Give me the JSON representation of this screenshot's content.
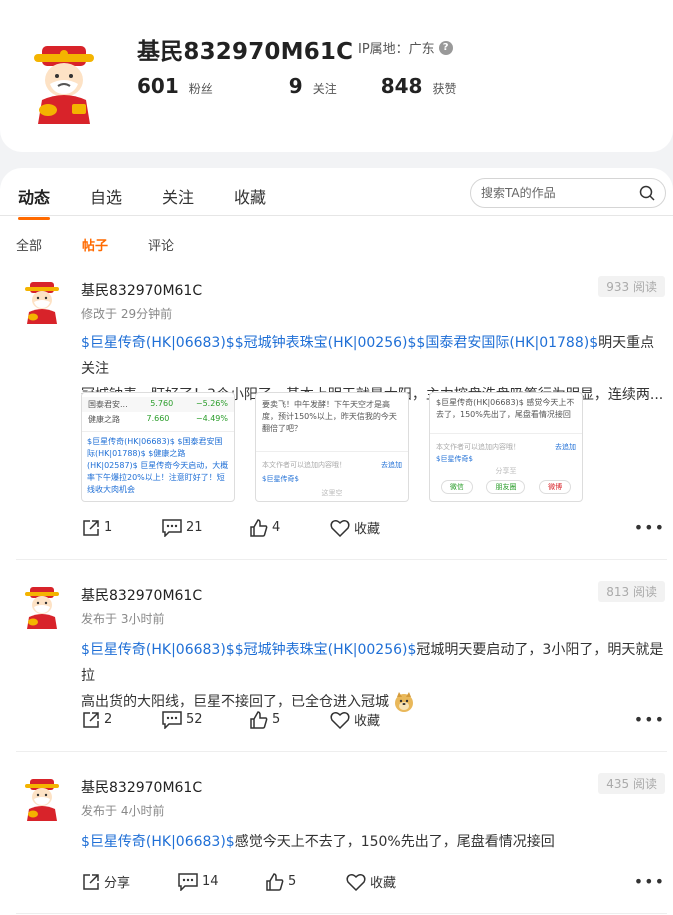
{
  "profile": {
    "username": "基民832970M61C",
    "ip_label": "IP属地：广东",
    "stats": [
      {
        "num": "601",
        "label": "粉丝"
      },
      {
        "num": "9",
        "label": "关注"
      },
      {
        "num": "848",
        "label": "获赞"
      }
    ]
  },
  "tabs": [
    "动态",
    "自选",
    "关注",
    "收藏"
  ],
  "search": {
    "placeholder": "搜索TA的作品"
  },
  "subtabs": [
    "全部",
    "帖子",
    "评论"
  ],
  "posts": [
    {
      "author": "基民832970M61C",
      "time": "修改于 29分钟前",
      "reads": "933 阅读",
      "tags": [
        "$巨星传奇(HK|06683)$",
        "$冠城钟表珠宝(HK|00256)$",
        "$国泰君安国际(HK|01788)$"
      ],
      "text": "明天重点关注",
      "text2": "冠城钟表，盯好了！3个小阳了，基本上明天就是大阳，主力控盘洗盘吸筹行为明显，连续两...",
      "share": "1",
      "comments": "21",
      "likes": "4",
      "fav": "收藏",
      "thumbs": {
        "t1": {
          "r1_name": "国泰君安...",
          "r1_val": "5.760",
          "r1_chg": "−5.26%",
          "r2_name": "健康之路",
          "r2_val": "7.660",
          "r2_chg": "−4.49%",
          "body": "$巨星传奇(HK|06683)$ $国泰君安国际(HK|01788)$ $健康之路(HK|02587)$ 巨星传奇今天启动，大概率下午爆拉20%以上！注意盯好了！短线收大肉机会"
        },
        "t2": {
          "body": "要卖飞！中午发酵！下午天空才是高度，预计150%以上，昨天信我的今天翻倍了吧？",
          "note": "本文作者可以追加内容哦！",
          "link": "去追加",
          "tag": "$巨星传奇$",
          "foot": "这里空"
        },
        "t3": {
          "body": "$巨星传奇(HK|06683)$ 感觉今天上不去了，150%先出了，尾盘看情况接回",
          "note": "本文作者可以追加内容哦！",
          "link": "去追加",
          "tag": "$巨星传奇$",
          "foot": "分享至",
          "s1": "微信",
          "s2": "朋友圈",
          "s3": "微博"
        }
      }
    },
    {
      "author": "基民832970M61C",
      "time": "发布于 3小时前",
      "reads": "813 阅读",
      "tags": [
        "$巨星传奇(HK|06683)$",
        "$冠城钟表珠宝(HK|00256)$"
      ],
      "text": "冠城明天要启动了，3小阳了，明天就是拉",
      "text2": "高出货的大阳线，巨星不接回了，已全仓进入冠城",
      "share": "2",
      "comments": "52",
      "likes": "5",
      "fav": "收藏"
    },
    {
      "author": "基民832970M61C",
      "time": "发布于 4小时前",
      "reads": "435 阅读",
      "tags": [
        "$巨星传奇(HK|06683)$"
      ],
      "text": "感觉今天上不去了，150%先出了，尾盘看情况接回",
      "share": "分享",
      "comments": "14",
      "likes": "5",
      "fav": "收藏"
    }
  ],
  "colors": {
    "accent": "#ff6a00",
    "link": "#1f6fd6"
  }
}
